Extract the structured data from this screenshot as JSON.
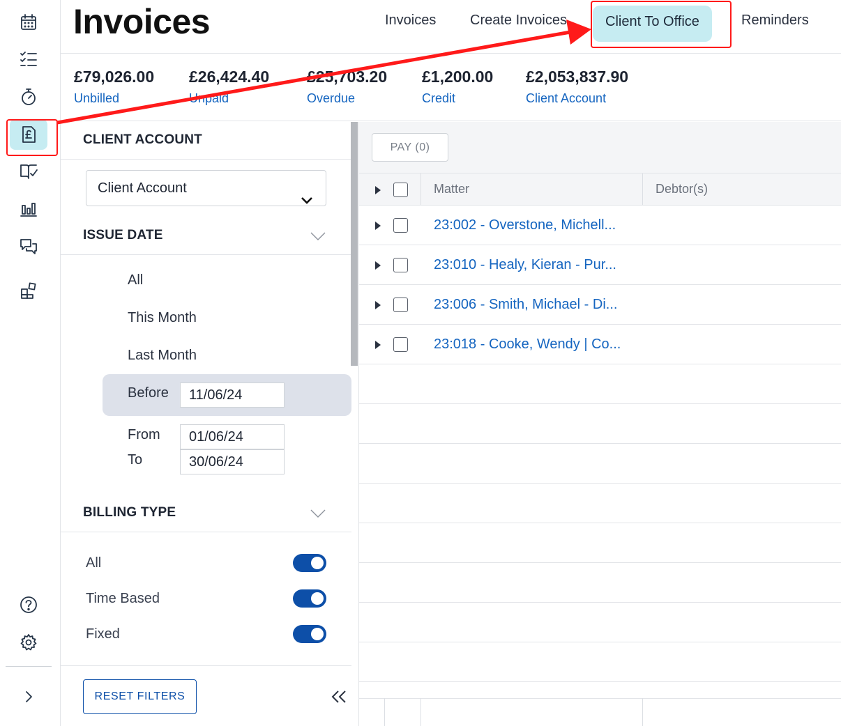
{
  "header": {
    "title": "Invoices",
    "tabs": [
      {
        "label": "Invoices"
      },
      {
        "label": "Create Invoices"
      },
      {
        "label": "Client To Office",
        "active": true
      },
      {
        "label": "Reminders"
      }
    ]
  },
  "summary": [
    {
      "amount": "£79,026.00",
      "label": "Unbilled"
    },
    {
      "amount": "£26,424.40",
      "label": "Unpaid"
    },
    {
      "amount": "£25,703.20",
      "label": "Overdue"
    },
    {
      "amount": "£1,200.00",
      "label": "Credit"
    },
    {
      "amount": "£2,053,837.90",
      "label": "Client Account"
    }
  ],
  "sidebar": {
    "icons": [
      "calendar-icon",
      "task-list-icon",
      "timer-icon",
      "invoice-pound-icon",
      "book-check-icon",
      "bar-chart-icon",
      "chat-icon",
      "apps-icon",
      "help-icon",
      "settings-icon",
      "expand-icon"
    ],
    "active": "invoice-pound-icon"
  },
  "filters": {
    "client_account": {
      "title": "CLIENT ACCOUNT",
      "selected": "Client Account"
    },
    "issue_date": {
      "title": "ISSUE DATE",
      "options": [
        "All",
        "This Month",
        "Last Month"
      ],
      "before_label": "Before",
      "before_value": "11/06/24",
      "from_label": "From",
      "from_value": "01/06/24",
      "to_label": "To",
      "to_value": "30/06/24",
      "selected": "Before"
    },
    "billing_type": {
      "title": "BILLING TYPE",
      "toggles": [
        {
          "label": "All",
          "on": true
        },
        {
          "label": "Time Based",
          "on": true
        },
        {
          "label": "Fixed",
          "on": true
        }
      ]
    },
    "reset_label": "RESET FILTERS"
  },
  "results": {
    "pay_label": "PAY (0)",
    "columns": [
      "Matter",
      "Debtor(s)"
    ],
    "rows": [
      {
        "matter": "23:002 - Overstone, Michell..."
      },
      {
        "matter": "23:010 - Healy, Kieran - Pur..."
      },
      {
        "matter": "23:006 - Smith, Michael - Di..."
      },
      {
        "matter": "23:018 - Cooke, Wendy | Co..."
      }
    ]
  },
  "colors": {
    "accent": "#c6ecf2",
    "link": "#1565c0",
    "toggle": "#0d4fa8",
    "annotation": "#ff1a1a"
  }
}
